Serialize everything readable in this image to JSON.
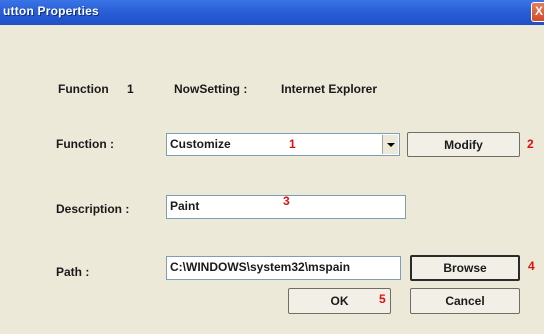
{
  "window": {
    "title": "utton Properties",
    "close_glyph": "X"
  },
  "info": {
    "function_label": "Function",
    "function_number": "1",
    "now_setting_label": "NowSetting :",
    "now_setting_value": "Internet Explorer"
  },
  "form": {
    "function_label": "Function :",
    "function_value": "Customize",
    "description_label": "Description :",
    "description_value": "Paint",
    "path_label": "Path :",
    "path_value": "C:\\WINDOWS\\system32\\mspain"
  },
  "buttons": {
    "modify": "Modify",
    "browse": "Browse",
    "ok": "OK",
    "cancel": "Cancel"
  },
  "markers": [
    "1",
    "2",
    "3",
    "4",
    "5"
  ],
  "colors": {
    "titlebar": "#2a5fd8",
    "dialog_bg": "#ece9d8",
    "marker": "#e01010",
    "close_button": "#d24a2a"
  },
  "icons": {
    "dropdown": "chevron-down-icon",
    "close": "close-icon"
  }
}
